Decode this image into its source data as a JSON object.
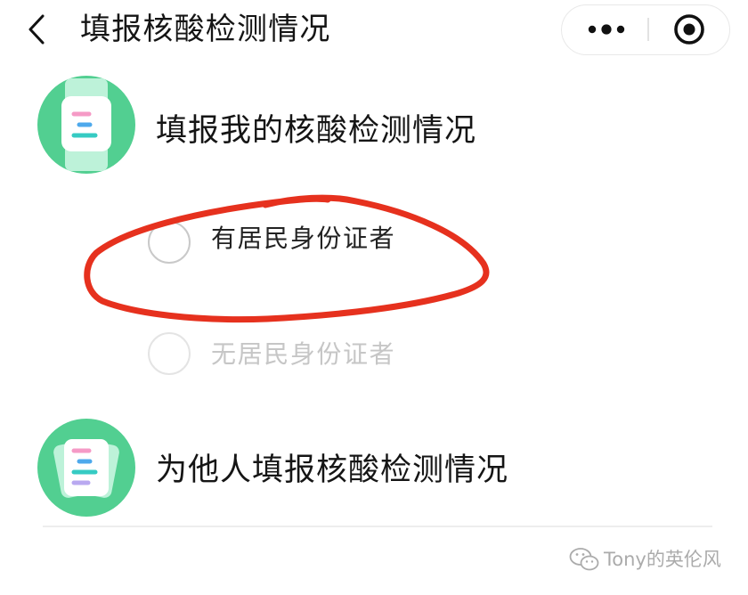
{
  "nav": {
    "title": "填报核酸检测情况",
    "back_icon": "chevron-left-icon",
    "more_icon": "more-dots-icon",
    "exit_icon": "record-circle-icon"
  },
  "options": [
    {
      "label": "填报我的核酸检测情况",
      "icon": "document-list-icon",
      "sub_options": [
        {
          "label": "有居民身份证者",
          "selected": false,
          "disabled": false
        },
        {
          "label": "无居民身份证者",
          "selected": false,
          "disabled": true
        }
      ]
    },
    {
      "label": "为他人填报核酸检测情况",
      "icon": "stacked-documents-icon"
    }
  ],
  "watermark": {
    "icon": "wechat-icon",
    "text": "Tony的英伦风"
  },
  "colors": {
    "accent_green": "#52CF91",
    "icon_pale_green": "#BDF2D9",
    "annotation_red": "#E6311E",
    "text_primary": "#151515",
    "text_disabled": "#C6C6C6",
    "radio_border": "#C9C9C9",
    "radio_border_disabled": "#E4E4E4",
    "divider": "#EDEDED",
    "watermark": "#ABABAB",
    "line_pink": "#F59AC6",
    "line_blue": "#4EA9EC",
    "line_teal": "#36CBC3",
    "line_purple": "#B9A9F0"
  }
}
